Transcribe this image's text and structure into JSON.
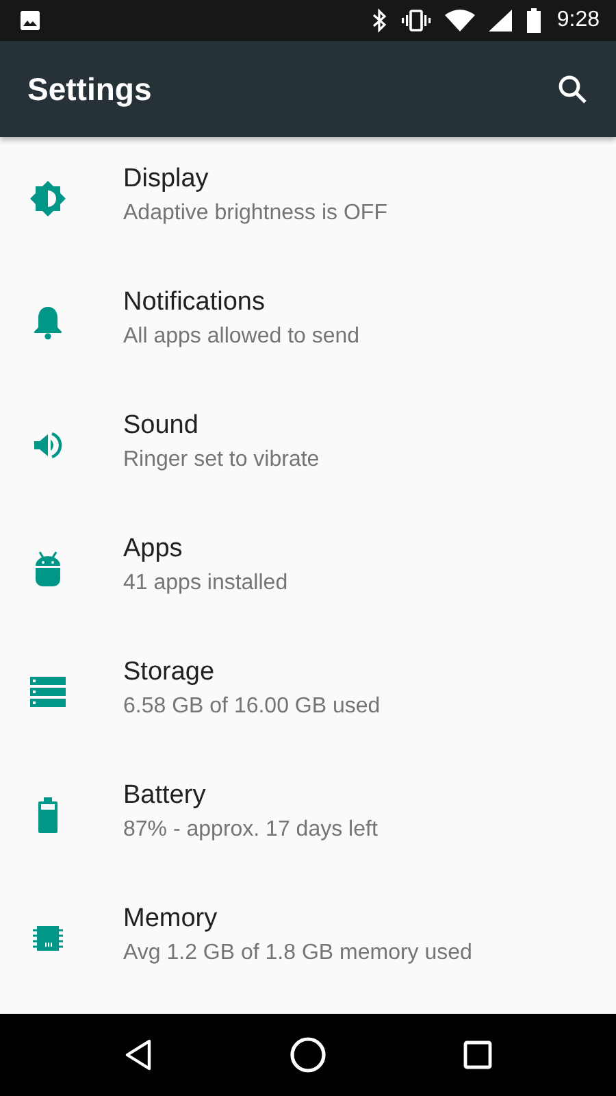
{
  "status_bar": {
    "time": "9:28"
  },
  "app_bar": {
    "title": "Settings"
  },
  "items": [
    {
      "kind": "display",
      "title": "Display",
      "summary": "Adaptive brightness is OFF"
    },
    {
      "kind": "notifications",
      "title": "Notifications",
      "summary": "All apps allowed to send"
    },
    {
      "kind": "sound",
      "title": "Sound",
      "summary": "Ringer set to vibrate"
    },
    {
      "kind": "apps",
      "title": "Apps",
      "summary": "41 apps installed"
    },
    {
      "kind": "storage",
      "title": "Storage",
      "summary": "6.58 GB of 16.00 GB used"
    },
    {
      "kind": "battery",
      "title": "Battery",
      "summary": "87% - approx. 17 days left"
    },
    {
      "kind": "memory",
      "title": "Memory",
      "summary": "Avg 1.2 GB of 1.8 GB memory used"
    }
  ]
}
